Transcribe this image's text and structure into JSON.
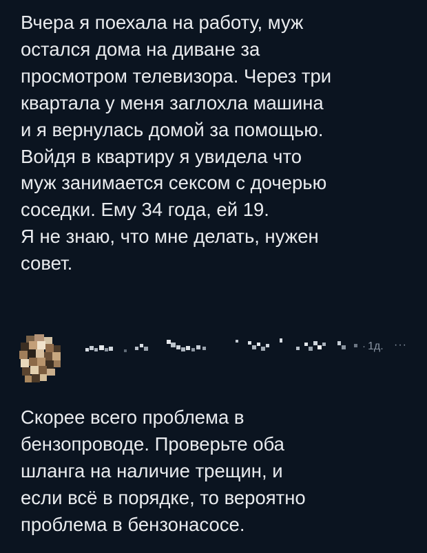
{
  "post": {
    "text": "Вчера я поехала на работу, муж\nостался дома на диване за\nпросмотром телевизора. Через три\nквартала у меня заглохла машина\nи я вернулась домой за помощью.\nВойдя в квартиру я увидела что\nмуж занимается сексом с дочерью\nсоседки. Ему 34 года, ей 19.\nЯ не знаю, что мне делать, нужен\nсовет."
  },
  "comment": {
    "avatar_icon": "pixelated-avatar-icon",
    "username_icon": "pixelated-username-icon",
    "separator": "·",
    "timestamp": "1д.",
    "more_label": "···",
    "text": "Скорее всего проблема в\nбензопроводе. Проверьте оба\nшланга на наличие трещин, и\nесли всё в порядке, то вероятно\nпроблема в бензонасосе."
  },
  "colors": {
    "background": "#0b1420",
    "text": "#e9ebee",
    "meta": "#8a95a3"
  }
}
